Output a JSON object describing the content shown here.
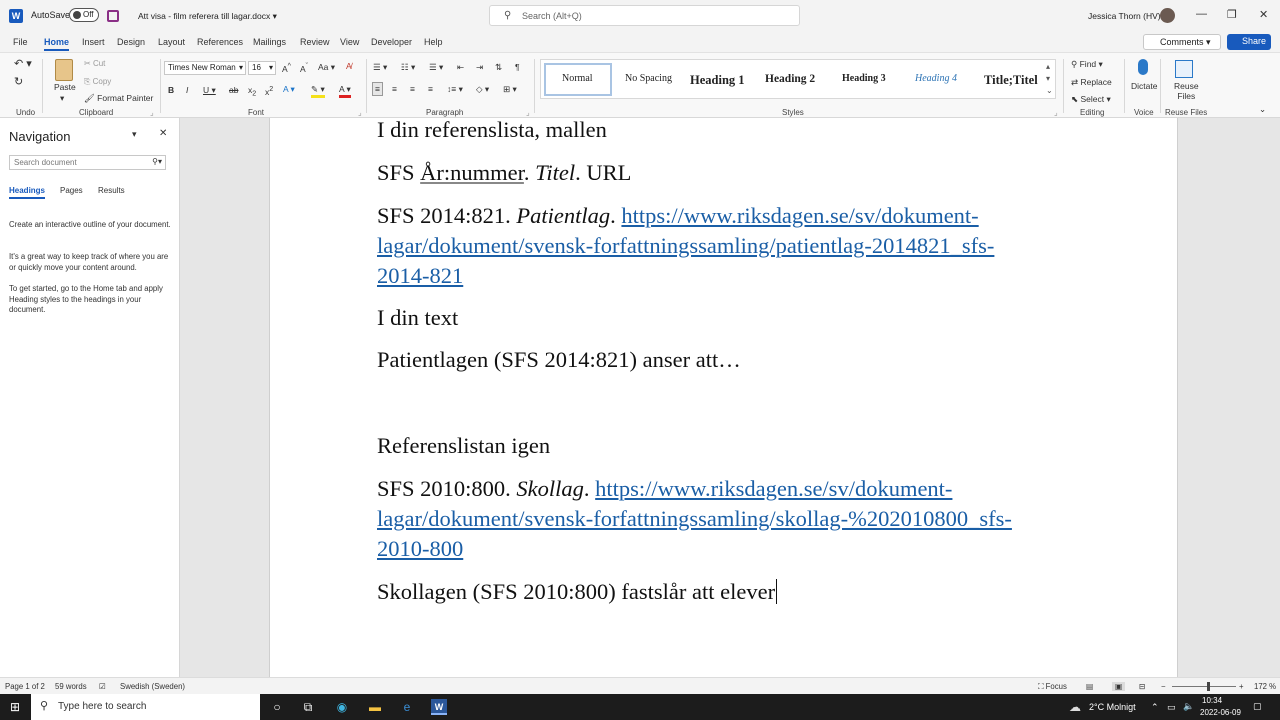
{
  "titlebar": {
    "app_icon": "W",
    "autosave_label": "AutoSave",
    "autosave_state": "Off",
    "doc_title": "Att visa - film referera till lagar.docx",
    "search_placeholder": "Search (Alt+Q)",
    "user_name": "Jessica Thorn (HV)"
  },
  "tabs": [
    "File",
    "Home",
    "Insert",
    "Design",
    "Layout",
    "References",
    "Mailings",
    "Review",
    "View",
    "Developer",
    "Help"
  ],
  "comments_label": "Comments",
  "share_label": "Share",
  "ribbon": {
    "undo_label": "Undo",
    "paste_label": "Paste",
    "cut_label": "Cut",
    "copy_label": "Copy",
    "format_painter_label": "Format Painter",
    "clipboard_label": "Clipboard",
    "font_name": "Times New Roman",
    "font_size": "16",
    "font_label": "Font",
    "paragraph_label": "Paragraph",
    "styles": [
      "Normal",
      "No Spacing",
      "Heading 1",
      "Heading 2",
      "Heading 3",
      "Heading 4",
      "Title;Titel"
    ],
    "styles_label": "Styles",
    "find_label": "Find",
    "replace_label": "Replace",
    "select_label": "Select",
    "editing_label": "Editing",
    "dictate_label": "Dictate",
    "voice_label": "Voice",
    "reuse_label": "Reuse Files",
    "reuse_btn_line1": "Reuse",
    "reuse_btn_line2": "Files"
  },
  "navigation": {
    "title": "Navigation",
    "search_placeholder": "Search document",
    "tabs": [
      "Headings",
      "Pages",
      "Results"
    ],
    "help1": "Create an interactive outline of your document.",
    "help2": "It's a great way to keep track of where you are or quickly move your content around.",
    "help3": "To get started, go to the Home tab and apply Heading styles to the headings in your document."
  },
  "document": {
    "l1": "I din referenslista, mallen",
    "l2a": "SFS ",
    "l2b": "År:nummer",
    "l2c": ". ",
    "l2d": "Titel",
    "l2e": ". URL",
    "l3a": "SFS 2014:821. ",
    "l3b": "Patientlag",
    "l3c": ". ",
    "l3link1": "https://www.riksdagen.se/sv/dokument-",
    "l3link2": "lagar/dokument/svensk-forfattningssamling/patientlag-2014821_sfs-",
    "l3link3": "2014-821",
    "l4": "I din text",
    "l5": "Patientlagen (SFS 2014:821) anser att…",
    "l6": "Referenslistan igen",
    "l7a": "SFS 2010:800. ",
    "l7b": "Skollag",
    "l7c": ". ",
    "l7link1": "https://www.riksdagen.se/sv/dokument-",
    "l7link2": "lagar/dokument/svensk-forfattningssamling/skollag-%202010800_sfs-",
    "l7link3": "2010-800",
    "l8": "Skollagen (SFS 2010:800) fastslår att elever"
  },
  "status": {
    "page": "Page 1 of 2",
    "words": "59 words",
    "language": "Swedish (Sweden)",
    "focus": "Focus",
    "zoom": "172 %"
  },
  "taskbar": {
    "search_placeholder": "Type here to search",
    "weather": "2°C  Molnigt",
    "time": "10:34",
    "date": "2022-06-09"
  }
}
